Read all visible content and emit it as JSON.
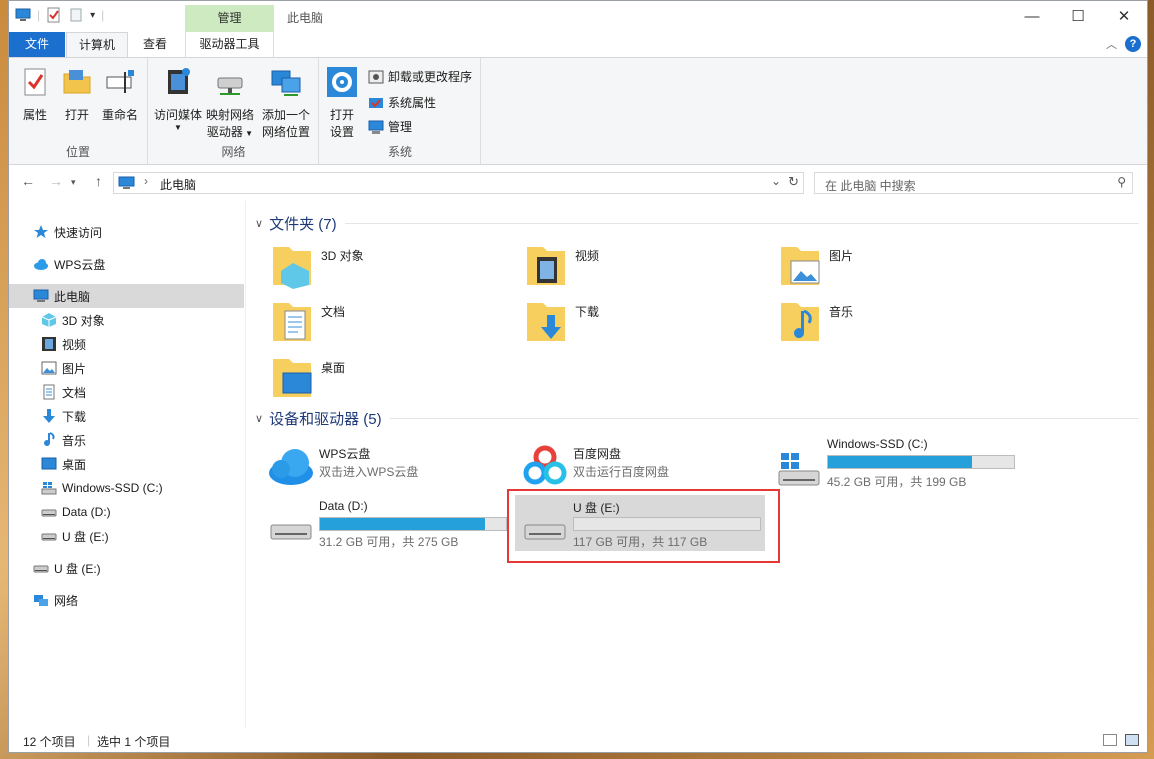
{
  "window": {
    "title": "此电脑",
    "manage_label": "管理",
    "minimize": "—",
    "maximize": "☐",
    "close": "✕"
  },
  "tabs": {
    "file": "文件",
    "computer": "计算机",
    "view": "查看",
    "drive_tools": "驱动器工具"
  },
  "ribbon": {
    "location": {
      "label": "位置",
      "properties": "属性",
      "open": "打开",
      "rename": "重命名"
    },
    "network": {
      "label": "网络",
      "media": "访问媒体",
      "map_drive_1": "映射网络",
      "map_drive_2": "驱动器",
      "add_loc_1": "添加一个",
      "add_loc_2": "网络位置"
    },
    "system": {
      "label": "系统",
      "open_settings_1": "打开",
      "open_settings_2": "设置",
      "uninstall": "卸载或更改程序",
      "sysprops": "系统属性",
      "manage": "管理"
    }
  },
  "navbar": {
    "path": "此电脑",
    "search_placeholder": "在 此电脑 中搜索"
  },
  "sidebar": {
    "quick_access": "快速访问",
    "wps": "WPS云盘",
    "this_pc": "此电脑",
    "objects3d": "3D 对象",
    "videos": "视频",
    "pictures": "图片",
    "documents": "文档",
    "downloads": "下载",
    "music": "音乐",
    "desktop": "桌面",
    "c_drive": "Windows-SSD (C:)",
    "d_drive": "Data (D:)",
    "e_drive": "U 盘 (E:)",
    "e_drive_root": "U 盘 (E:)",
    "network": "网络"
  },
  "folders": {
    "header": "文件夹 (7)",
    "items": [
      "3D 对象",
      "视频",
      "图片",
      "文档",
      "下载",
      "音乐",
      "桌面"
    ]
  },
  "devices": {
    "header": "设备和驱动器 (5)",
    "wps": {
      "name": "WPS云盘",
      "sub": "双击进入WPS云盘"
    },
    "baidu": {
      "name": "百度网盘",
      "sub": "双击运行百度网盘"
    },
    "c": {
      "name": "Windows-SSD (C:)",
      "sub": "45.2 GB 可用，共 199 GB",
      "used_fraction": 0.773
    },
    "d": {
      "name": "Data (D:)",
      "sub": "31.2 GB 可用，共 275 GB",
      "used_fraction": 0.887
    },
    "e": {
      "name": "U 盘 (E:)",
      "sub": "117 GB 可用，共 117 GB",
      "used_fraction": 0.0
    }
  },
  "status": {
    "count": "12 个项目",
    "selected": "选中 1 个项目"
  },
  "colors": {
    "accent": "#1a6fcf",
    "bar_fill": "#26a0da",
    "manage_tab": "#cdeac0",
    "highlight_box": "#e53935"
  }
}
